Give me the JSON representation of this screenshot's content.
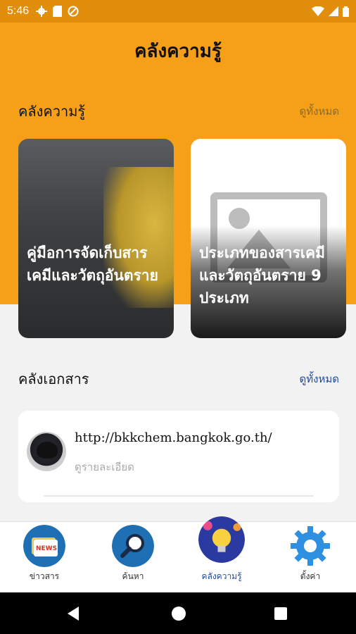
{
  "status_bar": {
    "time": "5:46",
    "icons": [
      "gear-icon",
      "sd-card-icon",
      "no-disturb-icon"
    ],
    "right_icons": [
      "wifi-icon",
      "signal-icon",
      "battery-icon"
    ]
  },
  "header": {
    "title": "คลังความรู้"
  },
  "knowledge_section": {
    "title": "คลังความรู้",
    "see_all": "ดูทั้งหมด",
    "cards": [
      {
        "title": "คู่มือการจัดเก็บสารเคมีและวัตถุอันตราย"
      },
      {
        "title": "ประเภทของสารเคมีและวัตถุอันตราย 9 ประเภท"
      }
    ]
  },
  "documents_section": {
    "title": "คลังเอกสาร",
    "see_all": "ดูทั้งหมด",
    "items": [
      {
        "url": "http://bkkchem.bangkok.go.th/",
        "detail": "ดูรายละเอียด"
      }
    ]
  },
  "bottom_nav": {
    "items": [
      {
        "label": "ข่าวสาร",
        "icon": "news-icon"
      },
      {
        "label": "ค้นหา",
        "icon": "search-icon"
      },
      {
        "label": "คลังความรู้",
        "icon": "lightbulb-icon",
        "active": true
      },
      {
        "label": "ตั้งค่า",
        "icon": "gear-icon"
      }
    ]
  },
  "colors": {
    "accent": "#f6a01a",
    "status_bar": "#e08e0b",
    "link_blue": "#1f4a9e"
  }
}
